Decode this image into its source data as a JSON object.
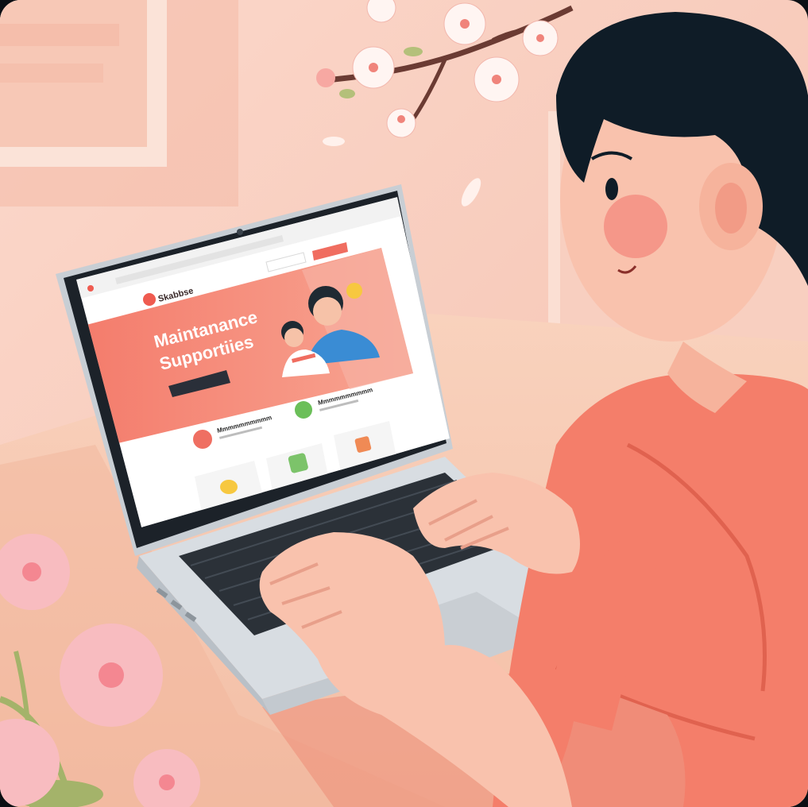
{
  "screen": {
    "logo_text": "Skabbse",
    "hero_title_line1": "Maintanance",
    "hero_title_line2": "Supportiies",
    "item_a_title": "Mmmmmmmmmm",
    "item_b_title": "Mmmmmmmmmm"
  },
  "palette": {
    "wall": "#f8cdbf",
    "shirt": "#f47e6a",
    "hair": "#0f1c27",
    "skin": "#f9c2ad",
    "accent": "#ef6f62"
  },
  "icons": [
    "browser-close-icon",
    "site-logo-icon",
    "smile-badge-icon",
    "scale-icon",
    "leaf-icon",
    "card-icon-yellow",
    "card-icon-green",
    "card-icon-orange",
    "webcam-icon"
  ]
}
